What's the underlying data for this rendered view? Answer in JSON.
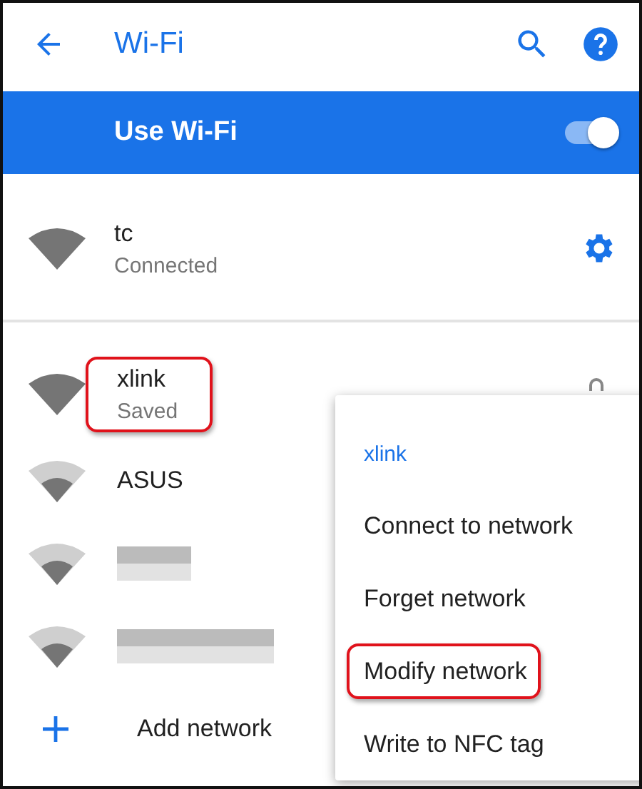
{
  "app_bar": {
    "title": "Wi-Fi"
  },
  "master_switch": {
    "label": "Use Wi-Fi",
    "on": true
  },
  "connected": {
    "name": "tc",
    "status": "Connected",
    "strong_signal": true
  },
  "networks": [
    {
      "kind": "network",
      "name": "xlink",
      "status": "Saved",
      "strong_signal": true,
      "locked": true,
      "highlighted": true
    },
    {
      "kind": "network",
      "name": "ASUS",
      "strong_signal": false,
      "locked": false,
      "highlighted": false
    },
    {
      "kind": "redacted",
      "strong_signal": false
    },
    {
      "kind": "redacted",
      "strong_signal": false
    },
    {
      "kind": "add",
      "name": "Add network"
    }
  ],
  "context_menu": {
    "title": "xlink",
    "items": [
      {
        "label": "Connect to network",
        "highlighted": false
      },
      {
        "label": "Forget network",
        "highlighted": false
      },
      {
        "label": "Modify network",
        "highlighted": true
      },
      {
        "label": "Write to NFC tag",
        "highlighted": false
      }
    ]
  }
}
